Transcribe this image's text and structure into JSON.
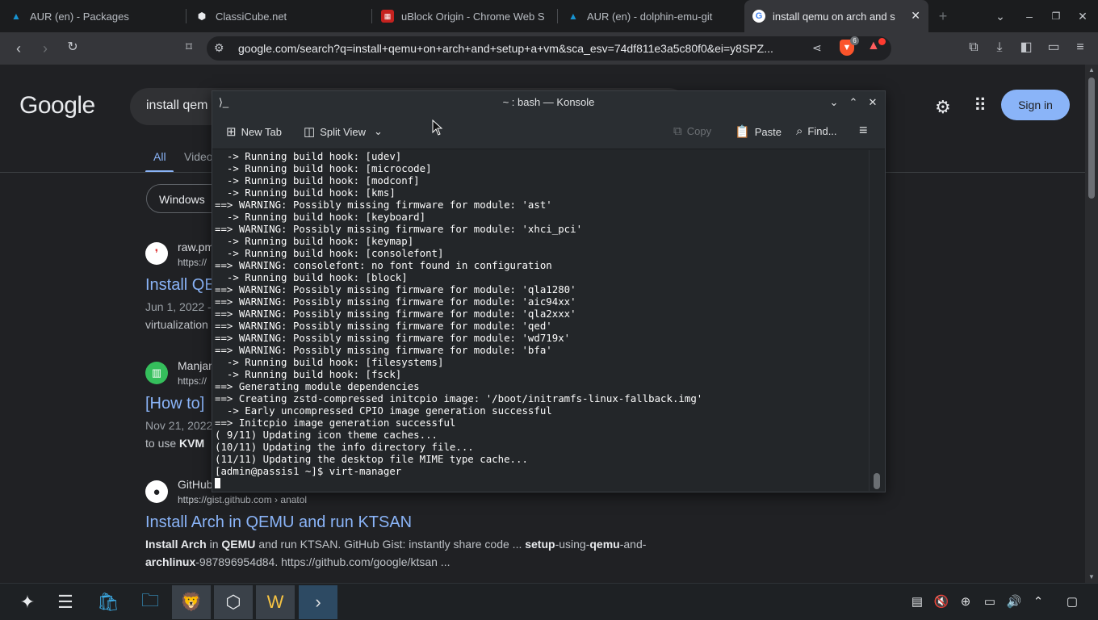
{
  "browser": {
    "tabs": [
      {
        "title": "AUR (en) - Packages",
        "icon": "arch-icon"
      },
      {
        "title": "ClassiCube.net",
        "icon": "cube-icon"
      },
      {
        "title": "uBlock Origin - Chrome Web S",
        "icon": "chrome-web-store-icon"
      },
      {
        "title": "AUR (en) - dolphin-emu-git",
        "icon": "arch-icon"
      },
      {
        "title": "install qemu on arch and s",
        "icon": "google-icon",
        "active": true
      }
    ],
    "new_tab_symbol": "+",
    "url": "google.com/search?q=install+qemu+on+arch+and+setup+a+vm&sca_esv=74df811e3a5c80f0&ei=y8SPZ...",
    "brave_badge": "6"
  },
  "google": {
    "logo": "Google",
    "query": "install qem",
    "signin_label": "Sign in",
    "tabs": [
      "All",
      "Video"
    ],
    "chip": "Windows",
    "results": [
      {
        "site": "raw.pm",
        "url": "https://",
        "title": "Install QE",
        "date": "Jun 1, 2022 -",
        "snippet": "virtualization"
      },
      {
        "site": "Manjar",
        "url": "https://",
        "title": "[How to] ",
        "date": "Nov 21, 2022",
        "snippet_pre": "to use ",
        "snippet_bold": "KVM",
        "snippet_post": " "
      },
      {
        "site": "GitHub",
        "url": "https://gist.github.com › anatol",
        "title": "Install Arch in QEMU and run KTSAN"
      }
    ],
    "gist_snippet": {
      "line1": [
        {
          "t": "Install Arch",
          "b": true
        },
        {
          "t": " in ",
          "b": false
        },
        {
          "t": "QEMU",
          "b": true
        },
        {
          "t": " and run KTSAN. GitHub Gist: instantly share code ... ",
          "b": false
        },
        {
          "t": "setup",
          "b": true
        },
        {
          "t": "-using-",
          "b": false
        },
        {
          "t": "qemu",
          "b": true
        },
        {
          "t": "-and-",
          "b": false
        }
      ],
      "line2": [
        {
          "t": "archlinux",
          "b": true
        },
        {
          "t": "-987896954d84. https://github.com/google/ktsan ...",
          "b": false
        }
      ]
    }
  },
  "konsole": {
    "title": "~ : bash — Konsole",
    "toolbar": {
      "new_tab": "New Tab",
      "split_view": "Split View",
      "copy": "Copy",
      "paste": "Paste",
      "find": "Find..."
    },
    "lines": [
      "  -> Running build hook: [udev]",
      "  -> Running build hook: [microcode]",
      "  -> Running build hook: [modconf]",
      "  -> Running build hook: [kms]",
      "==> WARNING: Possibly missing firmware for module: 'ast'",
      "  -> Running build hook: [keyboard]",
      "==> WARNING: Possibly missing firmware for module: 'xhci_pci'",
      "  -> Running build hook: [keymap]",
      "  -> Running build hook: [consolefont]",
      "==> WARNING: consolefont: no font found in configuration",
      "  -> Running build hook: [block]",
      "==> WARNING: Possibly missing firmware for module: 'qla1280'",
      "==> WARNING: Possibly missing firmware for module: 'aic94xx'",
      "==> WARNING: Possibly missing firmware for module: 'qla2xxx'",
      "==> WARNING: Possibly missing firmware for module: 'qed'",
      "==> WARNING: Possibly missing firmware for module: 'wd719x'",
      "==> WARNING: Possibly missing firmware for module: 'bfa'",
      "  -> Running build hook: [filesystems]",
      "  -> Running build hook: [fsck]",
      "==> Generating module dependencies",
      "==> Creating zstd-compressed initcpio image: '/boot/initramfs-linux-fallback.img'",
      "  -> Early uncompressed CPIO image generation successful",
      "==> Initcpio image generation successful",
      "( 9/11) Updating icon theme caches...",
      "(10/11) Updating the info directory file...",
      "(11/11) Updating the desktop file MIME type cache...",
      "[admin@passis1 ~]$ virt-manager"
    ]
  },
  "taskbar": {
    "apps": [
      {
        "name": "application-launcher-icon",
        "glyph": "✦"
      },
      {
        "name": "system-settings-icon",
        "glyph": "☰"
      },
      {
        "name": "discover-store-icon",
        "glyph": "🛍"
      },
      {
        "name": "file-manager-icon",
        "glyph": "🗀"
      },
      {
        "name": "brave-browser-icon",
        "glyph": "🦁"
      },
      {
        "name": "virt-manager-icon",
        "glyph": "⬡"
      },
      {
        "name": "w-app-icon",
        "glyph": "W"
      },
      {
        "name": "konsole-icon",
        "glyph": "›"
      }
    ]
  }
}
